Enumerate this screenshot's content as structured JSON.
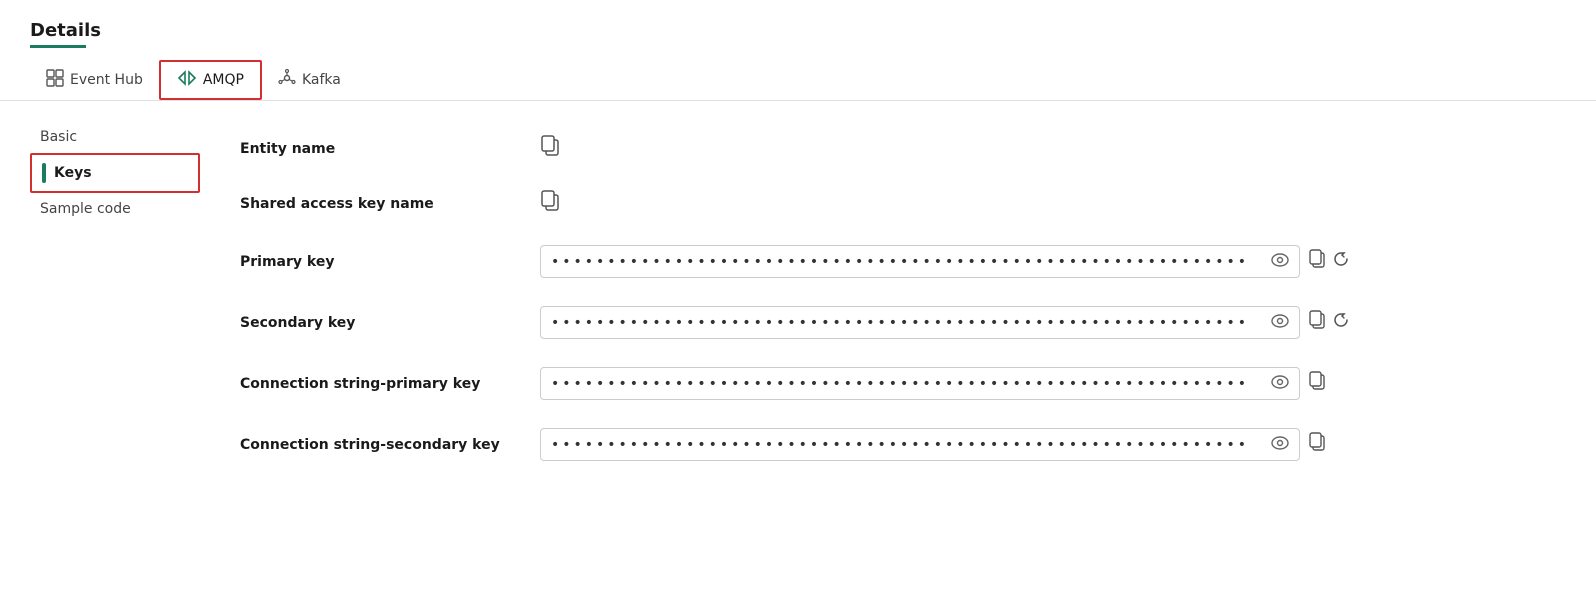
{
  "page": {
    "title": "Details",
    "title_underline_color": "#1a7c5e"
  },
  "tabs": [
    {
      "id": "event-hub",
      "label": "Event Hub",
      "icon": "⊞",
      "active": false,
      "outlined": false
    },
    {
      "id": "amqp",
      "label": "AMQP",
      "icon": "◇◇",
      "active": true,
      "outlined": true
    },
    {
      "id": "kafka",
      "label": "Kafka",
      "icon": "⁂",
      "active": false,
      "outlined": false
    }
  ],
  "sidebar": {
    "items": [
      {
        "id": "basic",
        "label": "Basic",
        "active": false
      },
      {
        "id": "keys",
        "label": "Keys",
        "active": true
      },
      {
        "id": "sample-code",
        "label": "Sample code",
        "active": false
      }
    ]
  },
  "fields": [
    {
      "id": "entity-name",
      "label": "Entity name",
      "has_input_box": false,
      "has_copy": true,
      "has_refresh": false,
      "dots": ""
    },
    {
      "id": "shared-access-key-name",
      "label": "Shared access key name",
      "has_input_box": false,
      "has_copy": true,
      "has_refresh": false,
      "dots": ""
    },
    {
      "id": "primary-key",
      "label": "Primary key",
      "has_input_box": true,
      "has_copy": true,
      "has_refresh": true,
      "dots": "••••••••••••••••••••••••••••••••••••••••••••••••••••••••••••••"
    },
    {
      "id": "secondary-key",
      "label": "Secondary key",
      "has_input_box": true,
      "has_copy": true,
      "has_refresh": true,
      "dots": "••••••••••••••••••••••••••••••••••••••••••••••••••••••••••••••"
    },
    {
      "id": "connection-string-primary",
      "label": "Connection string-primary key",
      "has_input_box": true,
      "has_copy": true,
      "has_refresh": false,
      "dots": "••••••••••••••••••••••••••••••••••••••••••••••••••••••••••••••"
    },
    {
      "id": "connection-string-secondary",
      "label": "Connection string-secondary key",
      "has_input_box": true,
      "has_copy": true,
      "has_refresh": false,
      "dots": "••••••••••••••••••••••••••••••••••••••••••••••••••••••••••••••"
    }
  ],
  "icons": {
    "copy": "⧉",
    "eye": "👁",
    "refresh": "↺"
  }
}
